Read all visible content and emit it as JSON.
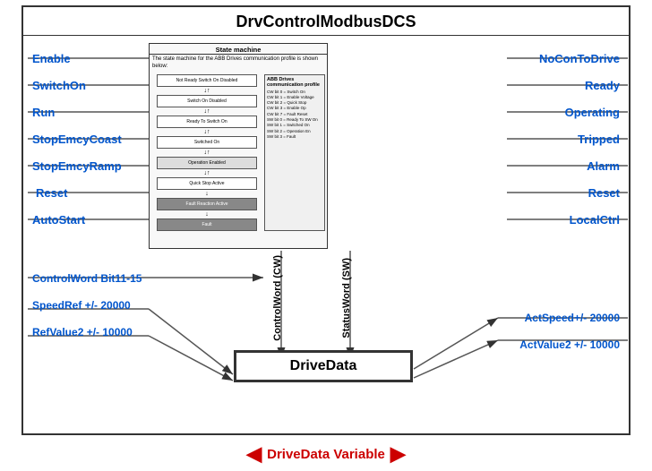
{
  "title": "DrvControlModbusDCS",
  "stateMachine": {
    "title": "State machine",
    "subtitle": "The state machine for the ABB Drives communication profile is shown below:",
    "rightBoxTitle": "ABB Drives communication profile"
  },
  "leftLabels": [
    "Enable",
    "SwitchOn",
    "Run",
    "StopEmcyCoast",
    "StopEmcyRamp",
    "Reset",
    "AutoStart"
  ],
  "rightLabels": [
    "NoConToDrive",
    "Ready",
    "Operating",
    "Tripped",
    "Alarm",
    "Reset",
    "LocalCtrl"
  ],
  "bottomLeftLabels": [
    "ControlWord Bit11-15",
    "SpeedRef +/- 20000",
    "RefValue2 +/- 10000"
  ],
  "bottomRightLabels": [
    "ActSpeed+/- 20000",
    "ActValue2 +/- 10000"
  ],
  "cwLabel": "ControlWord (CW)",
  "swLabel": "StatusWord (SW)",
  "driveDataLabel": "DriveData",
  "bottomVariable": "DriveData Variable"
}
